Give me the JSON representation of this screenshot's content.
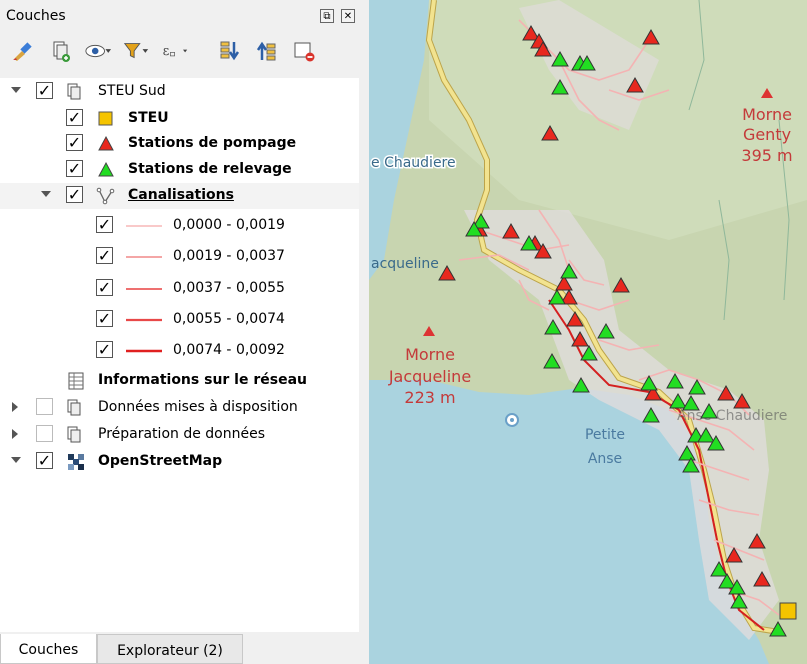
{
  "panel": {
    "title": "Couches",
    "btn_float": "⧉",
    "btn_close": "✕"
  },
  "toolbar": {
    "items": [
      "style-brush-icon",
      "add-group-icon",
      "visibility-eye-icon",
      "filter-legend-icon",
      "filter-expression-icon",
      "expand-all-icon",
      "collapse-all-icon",
      "remove-layer-icon"
    ]
  },
  "tree": {
    "steu_sud": "STEU Sud",
    "steu": "STEU",
    "stations_pompage": "Stations de pompage",
    "stations_relevage": "Stations de relevage",
    "canalisations": "Canalisations",
    "classes": [
      "0,0000 - 0,0019",
      "0,0019 - 0,0037",
      "0,0037 - 0,0055",
      "0,0055 - 0,0074",
      "0,0074 - 0,0092"
    ],
    "informations": "Informations sur le réseau",
    "donnees_mises": "Données mises à disposition",
    "preparation": "Préparation de données",
    "osm": "OpenStreetMap"
  },
  "tabs": {
    "couches": "Couches",
    "explorateur": "Explorateur (2)"
  },
  "map": {
    "labels": {
      "chaudiere": "e Chaudiere",
      "jacqueline_left": "acqueline",
      "morne_genty": "Morne",
      "genty": "Genty",
      "genty_alt": "395 m",
      "morne_jacqueline": "Morne",
      "jacqueline": "Jacqueline",
      "jacqueline_alt": "223 m",
      "petite": "Petite",
      "anse": "Anse",
      "anse_chaudiere": "Anse Chaudiere"
    },
    "colors": {
      "sea": "#aad3df",
      "land": "#c8d5b0",
      "urban": "#e0dcdc",
      "road": "#f4b3b3",
      "pompage": "#e8281e",
      "relevage": "#22dd22",
      "steu": "#f5c400",
      "main_road": "#f2e38f"
    }
  }
}
